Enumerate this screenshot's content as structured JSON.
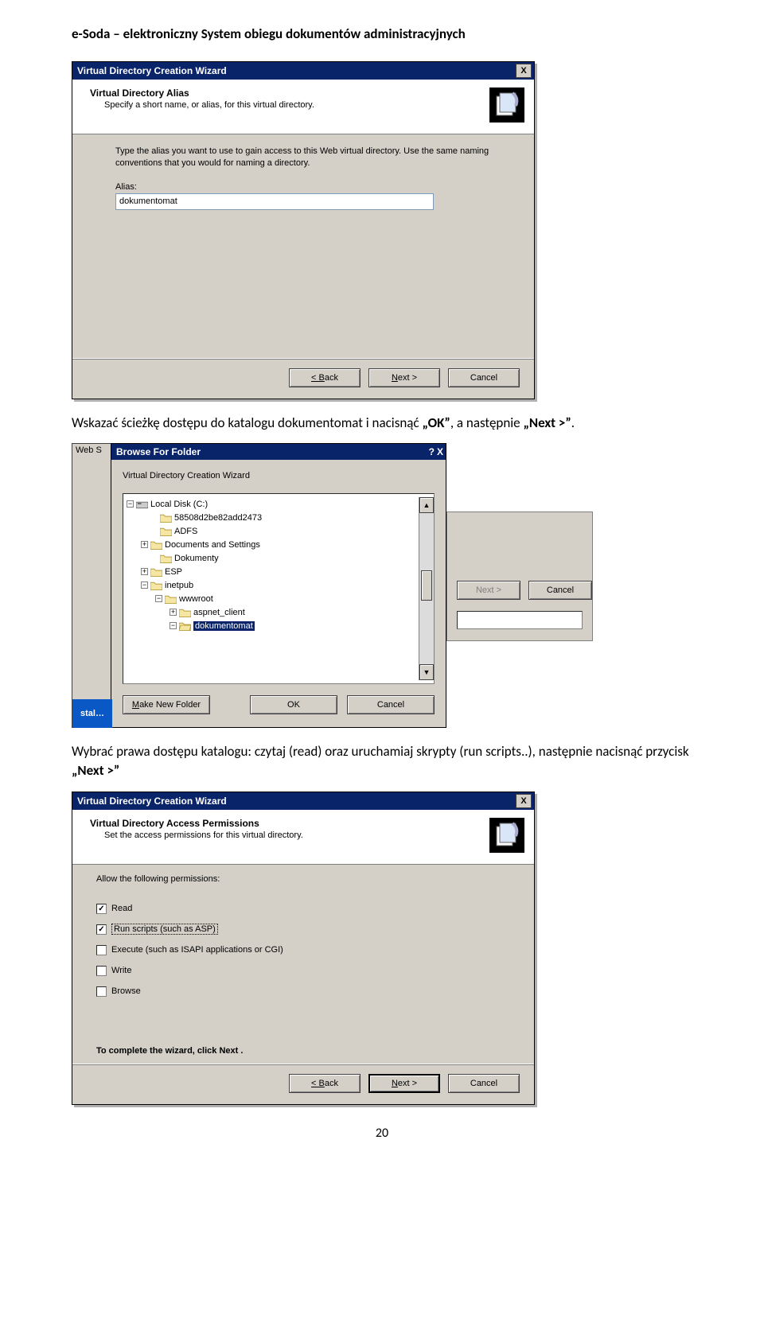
{
  "doc": {
    "header": "e-Soda – elektroniczny System obiegu dokumentów administracyjnych",
    "para1_prefix": "Wskazać ścieżkę dostępu do katalogu dokumentomat i nacisnąć ",
    "para1_ok": "OK",
    "para1_mid": ", a następnie ",
    "para1_next": "Next >",
    "para1_end": ".",
    "para2_prefix": "Wybrać prawa dostępu katalogu: czytaj (read) oraz uruchamiaj skrypty (run scripts..), następnie nacisnąć przycisk ",
    "para2_next": "Next >",
    "page_number": "20"
  },
  "dlg1": {
    "title": "Virtual Directory Creation Wizard",
    "close": "X",
    "h": "Virtual Directory Alias",
    "sub": "Specify a short name, or alias, for this virtual directory.",
    "instr": "Type the alias you want to use to gain access to this Web virtual directory. Use the same naming conventions that you would for naming a directory.",
    "alias_label": "Alias:",
    "alias_value": "dokumentomat",
    "back": "< Back",
    "next": "Next >",
    "cancel": "Cancel"
  },
  "browse": {
    "side_label": "Web S",
    "task_label": "stal…",
    "title": "Browse For Folder",
    "help": "?",
    "close": "X",
    "caption": "Virtual Directory Creation Wizard",
    "tree": {
      "disk": "Local Disk (C:)",
      "n1": "58508d2be82add2473",
      "n2": "ADFS",
      "n3": "Documents and Settings",
      "n4": "Dokumenty",
      "n5": "ESP",
      "n6": "inetpub",
      "n7": "wwwroot",
      "n8": "aspnet_client",
      "n9": "dokumentomat"
    },
    "make": "Make New Folder",
    "ok": "OK",
    "cancel": "Cancel",
    "back_next": "Next >",
    "back_cancel": "Cancel"
  },
  "dlg2": {
    "title": "Virtual Directory Creation Wizard",
    "close": "X",
    "h": "Virtual Directory Access Permissions",
    "sub": "Set the access permissions for this virtual directory.",
    "allow": "Allow the following permissions:",
    "p_read": "Read",
    "p_run": "Run scripts (such as ASP)",
    "p_exe": "Execute (such as ISAPI applications or CGI)",
    "p_write": "Write",
    "p_browse": "Browse",
    "complete": "To complete the wizard, click Next .",
    "back": "< Back",
    "next": "Next >",
    "cancel": "Cancel"
  }
}
